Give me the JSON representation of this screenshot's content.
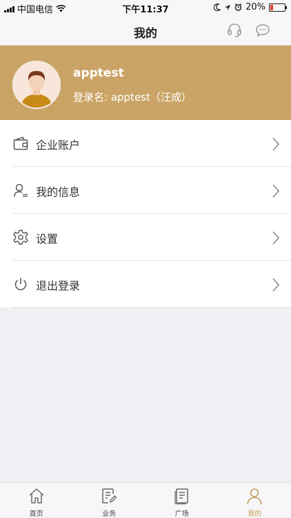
{
  "status_bar": {
    "carrier": "中国电信",
    "time": "下午11:37",
    "battery": "20%"
  },
  "nav": {
    "title": "我的",
    "headset_icon": "headset-icon",
    "chat_icon": "chat-bubble-icon"
  },
  "profile": {
    "username": "apptest",
    "login_label": "登录名: apptest（汪成）"
  },
  "menu": [
    {
      "label": "企业账户",
      "icon": "wallet-icon"
    },
    {
      "label": "我的信息",
      "icon": "user-info-icon"
    },
    {
      "label": "设置",
      "icon": "gear-icon"
    },
    {
      "label": "退出登录",
      "icon": "power-icon"
    }
  ],
  "tabs": [
    {
      "label": "首页",
      "icon": "home-icon",
      "active": false
    },
    {
      "label": "业务",
      "icon": "edit-document-icon",
      "active": false
    },
    {
      "label": "广场",
      "icon": "document-list-icon",
      "active": false
    },
    {
      "label": "我的",
      "icon": "person-icon",
      "active": true
    }
  ],
  "colors": {
    "accent": "#caa466",
    "active_tab": "#c79d5e",
    "battery_low": "#e0413a"
  }
}
